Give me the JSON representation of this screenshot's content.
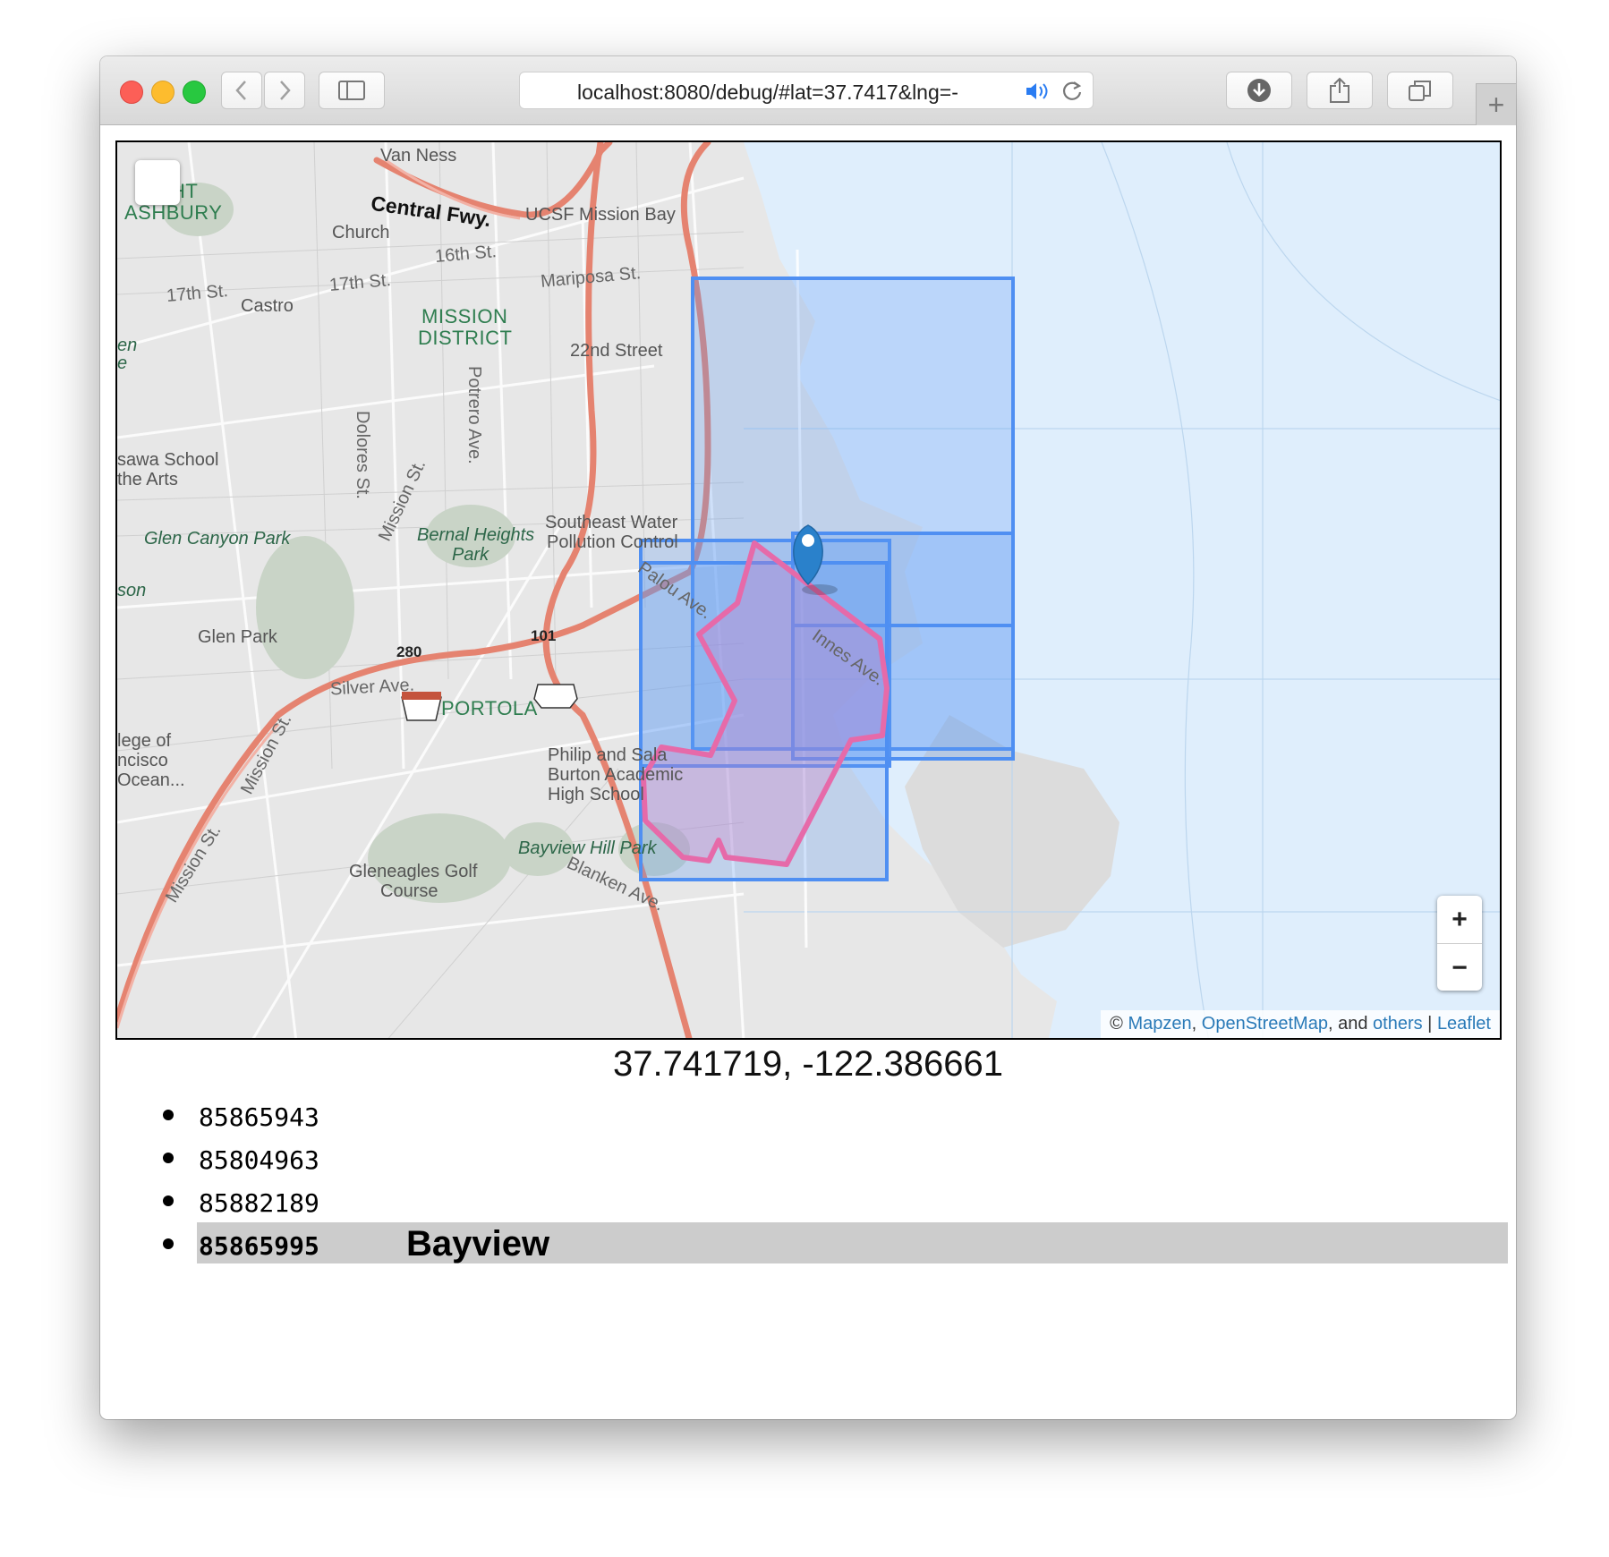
{
  "browser": {
    "url": "localhost:8080/debug/#lat=37.7417&lng=-",
    "controls": {
      "back_icon": "chevron-left-icon",
      "forward_icon": "chevron-right-icon",
      "sidebar_icon": "sidebar-icon",
      "download_icon": "download-icon",
      "share_icon": "share-icon",
      "tabs_icon": "tabs-icon",
      "new_tab_label": "+"
    }
  },
  "map": {
    "labels": {
      "van_ness": "Van Ness",
      "central_fwy": "Central Fwy.",
      "ucsf": "UCSF Mission Bay",
      "church": "Church",
      "sixteenth": "16th St.",
      "seventeenth_west": "17th St.",
      "seventeenth": "17th St.",
      "castro": "Castro",
      "mariposa": "Mariposa St.",
      "mission_district_1": "MISSION",
      "mission_district_2": "DISTRICT",
      "potrero": "Potrero Ave.",
      "twentysecond": "22nd Street",
      "ashbury_1": "HT",
      "ashbury_2": "ASHBURY",
      "dolores": "Dolores St.",
      "school_1": "sawa School",
      "school_2": "the Arts",
      "mission_st_1": "Mission St.",
      "bernal_1": "Bernal Heights",
      "bernal_2": "Park",
      "southeast_1": "Southeast Water",
      "southeast_2": "Pollution Control",
      "glen_canyon": "Glen Canyon Park",
      "palou": "Palou Ave.",
      "glen_park": "Glen Park",
      "highway_280": "280",
      "highway_101": "101",
      "innes": "Innes Ave.",
      "silver": "Silver Ave.",
      "portola": "PORTOLA",
      "college_1": "lege of",
      "college_2": "ncisco",
      "college_3": "Ocean...",
      "mission_st_2": "Mission St.",
      "mission_st_3": "Mission St.",
      "burton_1": "Philip and Sala",
      "burton_2": "Burton Academic",
      "burton_3": "High School",
      "bayview_hill": "Bayview Hill Park",
      "gleneagles_1": "Gleneagles Golf",
      "gleneagles_2": "Course",
      "blanken": "Blanken Ave.",
      "left_en": "en",
      "left_e": "e",
      "left_son": "son"
    },
    "zoom_in": "+",
    "zoom_out": "−",
    "attribution": {
      "copyright": "©",
      "mapzen": "Mapzen",
      "sep1": ",",
      "osm": "OpenStreetMap",
      "and": ", and",
      "others": "others",
      "pipe": "|",
      "leaflet": "Leaflet"
    },
    "colors": {
      "water": "#dfeefc",
      "land": "#e7e7e7",
      "highway": "#e58370",
      "bbox_stroke": "#4f8ff2",
      "bbox_fill": "#5c9bf3",
      "polygon_stroke": "#e66aa9",
      "marker": "#2a81cb"
    }
  },
  "coordinates": "37.741719, -122.386661",
  "results": [
    {
      "id": "85865943",
      "name": ""
    },
    {
      "id": "85804963",
      "name": ""
    },
    {
      "id": "85882189",
      "name": ""
    },
    {
      "id": "85865995",
      "name": "Bayview"
    }
  ]
}
